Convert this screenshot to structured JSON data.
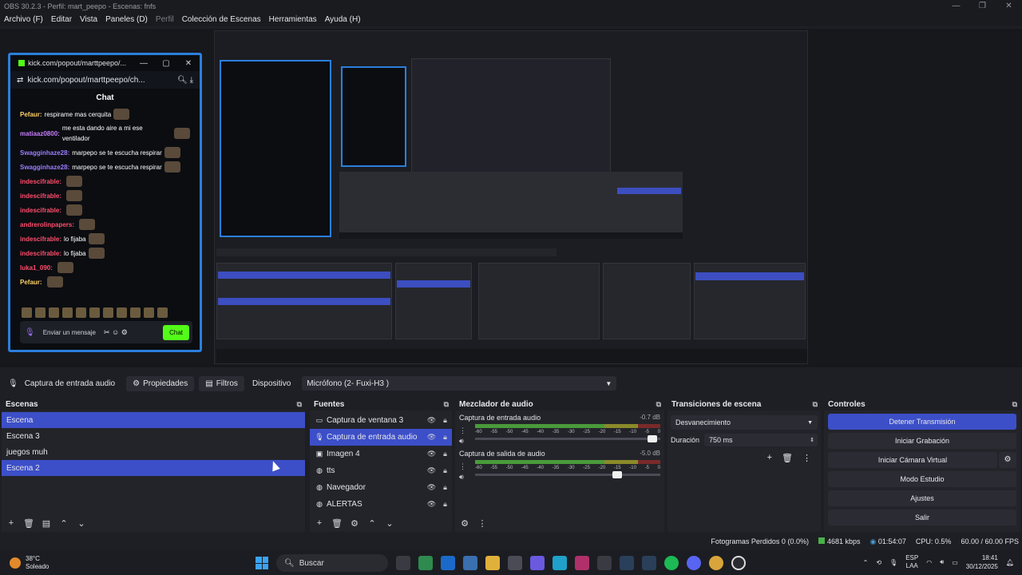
{
  "app": {
    "title": "OBS 30.2.3 - Perfil: mart_peepo - Escenas: fnfs"
  },
  "window_controls": [
    "—",
    "❐",
    "✕"
  ],
  "menu": [
    {
      "label": "Archivo (F)",
      "dim": false
    },
    {
      "label": "Editar",
      "dim": false
    },
    {
      "label": "Vista",
      "dim": false
    },
    {
      "label": "Paneles (D)",
      "dim": false
    },
    {
      "label": "Perfil",
      "dim": true
    },
    {
      "label": "Colección de Escenas",
      "dim": false
    },
    {
      "label": "Herramientas",
      "dim": false
    },
    {
      "label": "Ayuda (H)",
      "dim": false
    }
  ],
  "popout": {
    "title": "kick.com/popout/marttpeepo/...",
    "url": "kick.com/popout/marttpeepo/ch...",
    "header": "Chat",
    "messages": [
      {
        "user": "Pefaur:",
        "text": "respirame mas cerquita",
        "color": "#ffd166"
      },
      {
        "user": "matiaaz0800:",
        "text": "me esta dando aire a mi ese ventilador",
        "color": "#c77dff"
      },
      {
        "user": "Swagginhaze28:",
        "text": "marpepo se te escucha respirar",
        "color": "#9d7dff"
      },
      {
        "user": "Swagginhaze28:",
        "text": "marpepo se te escucha respirar",
        "color": "#9d7dff"
      },
      {
        "user": "indescifrable:",
        "text": "",
        "color": "#ff4d6d"
      },
      {
        "user": "indescifrable:",
        "text": "",
        "color": "#ff4d6d"
      },
      {
        "user": "indescifrable:",
        "text": "",
        "color": "#ff4d6d"
      },
      {
        "user": "andrerolinpapers:",
        "text": "",
        "color": "#ff4d6d"
      },
      {
        "user": "indescifrable:",
        "text": "lo fijaba",
        "color": "#ff4d6d"
      },
      {
        "user": "indescifrable:",
        "text": "lo fijaba",
        "color": "#ff4d6d"
      },
      {
        "user": "luka1_090:",
        "text": "",
        "color": "#ff4d6d"
      },
      {
        "user": "Pefaur:",
        "text": "",
        "color": "#ffd166"
      }
    ],
    "input_placeholder": "Enviar un mensaje",
    "send_label": "Chat"
  },
  "source_toolbar": {
    "source_name": "Captura de entrada audio",
    "properties": "Propiedades",
    "filters": "Filtros",
    "device_label": "Dispositivo",
    "device_value": "Micrófono (2- Fuxi-H3 )"
  },
  "scenes": {
    "title": "Escenas",
    "items": [
      {
        "label": "Escena",
        "selected": true
      },
      {
        "label": "Escena 3",
        "selected": false
      },
      {
        "label": "juegos muh",
        "selected": false
      },
      {
        "label": "Escena 2",
        "selected": true
      }
    ]
  },
  "sources": {
    "title": "Fuentes",
    "items": [
      {
        "label": "Captura de ventana 3",
        "icon": "window-icon",
        "glyph": "▭",
        "selected": false
      },
      {
        "label": "Captura de entrada audio",
        "icon": "mic-icon",
        "glyph": "🎙",
        "selected": true
      },
      {
        "label": "Imagen 4",
        "icon": "image-icon",
        "glyph": "▣",
        "selected": false
      },
      {
        "label": "tts",
        "icon": "browser-icon",
        "glyph": "◍",
        "selected": false
      },
      {
        "label": "Navegador",
        "icon": "browser-icon",
        "glyph": "◍",
        "selected": false
      },
      {
        "label": "ALERTAS",
        "icon": "browser-icon",
        "glyph": "◍",
        "selected": false
      }
    ]
  },
  "mixer": {
    "title": "Mezclador de audio",
    "ticks": [
      "-60",
      "-55",
      "-50",
      "-45",
      "-40",
      "-35",
      "-30",
      "-25",
      "-20",
      "-15",
      "-10",
      "-5",
      "0"
    ],
    "channels": [
      {
        "name": "Captura de entrada audio",
        "db": "-0.7 dB",
        "fader": 0.98
      },
      {
        "name": "Captura de salida de audio",
        "db": "-5.0 dB",
        "fader": 0.78
      }
    ]
  },
  "transitions": {
    "title": "Transiciones de escena",
    "selected": "Desvanecimiento",
    "duration_label": "Duración",
    "duration_value": "750 ms"
  },
  "controls": {
    "title": "Controles",
    "buttons": {
      "stop_stream": "Detener Transmisión",
      "start_record": "Iniciar Grabación",
      "virtual_cam": "Iniciar Cámara Virtual",
      "studio_mode": "Modo Estudio",
      "settings": "Ajustes",
      "exit": "Salir"
    }
  },
  "status": {
    "dropped": "Fotogramas Perdidos 0 (0.0%)",
    "bitrate": "4681 kbps",
    "time": "01:54:07",
    "cpu": "CPU: 0.5%",
    "fps": "60.00 / 60.00 FPS"
  },
  "taskbar": {
    "temp": "38°C",
    "weather": "Soleado",
    "search": "Buscar",
    "lang": "ESP",
    "lang2": "LAA",
    "time": "18:41",
    "date": "30/12/2025"
  },
  "colors": {
    "accent": "#3c4fc8",
    "kick": "#53fc18"
  }
}
